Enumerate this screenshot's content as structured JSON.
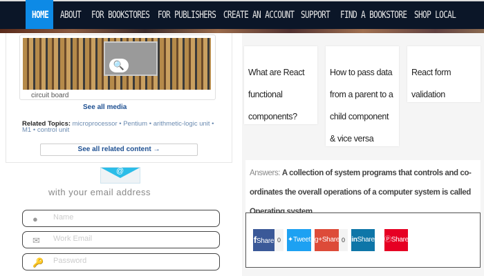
{
  "nav": {
    "items": [
      "HOME",
      "ABOUT",
      "FOR BOOKSTORES",
      "FOR PUBLISHERS",
      "CREATE AN ACCOUNT",
      "SUPPORT",
      "FIND A BOOKSTORE",
      "SHOP LOCAL"
    ],
    "active": "HOME",
    "active_color": "#0d8ae6"
  },
  "media": {
    "caption": "circuit board",
    "see_all_media": "See all media",
    "related_label": "Related Topics:",
    "related_topics": [
      "microprocessor",
      "Pentium",
      "arithmetic-logic unit",
      "M1",
      "control unit"
    ],
    "see_all_related": "See all related content →"
  },
  "signup": {
    "icon": "email-envelope-icon",
    "heading": "with your email address",
    "fields": [
      {
        "icon": "user-icon",
        "placeholder": "Name",
        "value": ""
      },
      {
        "icon": "envelope-icon",
        "placeholder": "Work Email",
        "value": ""
      },
      {
        "icon": "key-icon",
        "placeholder": "Password",
        "value": ""
      }
    ]
  },
  "cards": [
    "What are React functional components?",
    "How to pass data from a parent to a child component & vice versa",
    "React form validation"
  ],
  "answer": {
    "label": "Answers:",
    "text": "A collection of system programs that controls and co-ordinates the overall operations of a computer system is called Operating system."
  },
  "share": [
    {
      "network": "facebook",
      "label": "Share",
      "count": "0",
      "color": "#3b5998"
    },
    {
      "network": "twitter",
      "label": "Tweet",
      "color": "#1da1f2"
    },
    {
      "network": "google-plus",
      "label": "Share",
      "count": "0",
      "color": "#dd4b39"
    },
    {
      "network": "linkedin",
      "label": "Share",
      "color": "#0e76a8"
    },
    {
      "network": "pinterest",
      "label": "Share",
      "color": "#e60023"
    }
  ]
}
